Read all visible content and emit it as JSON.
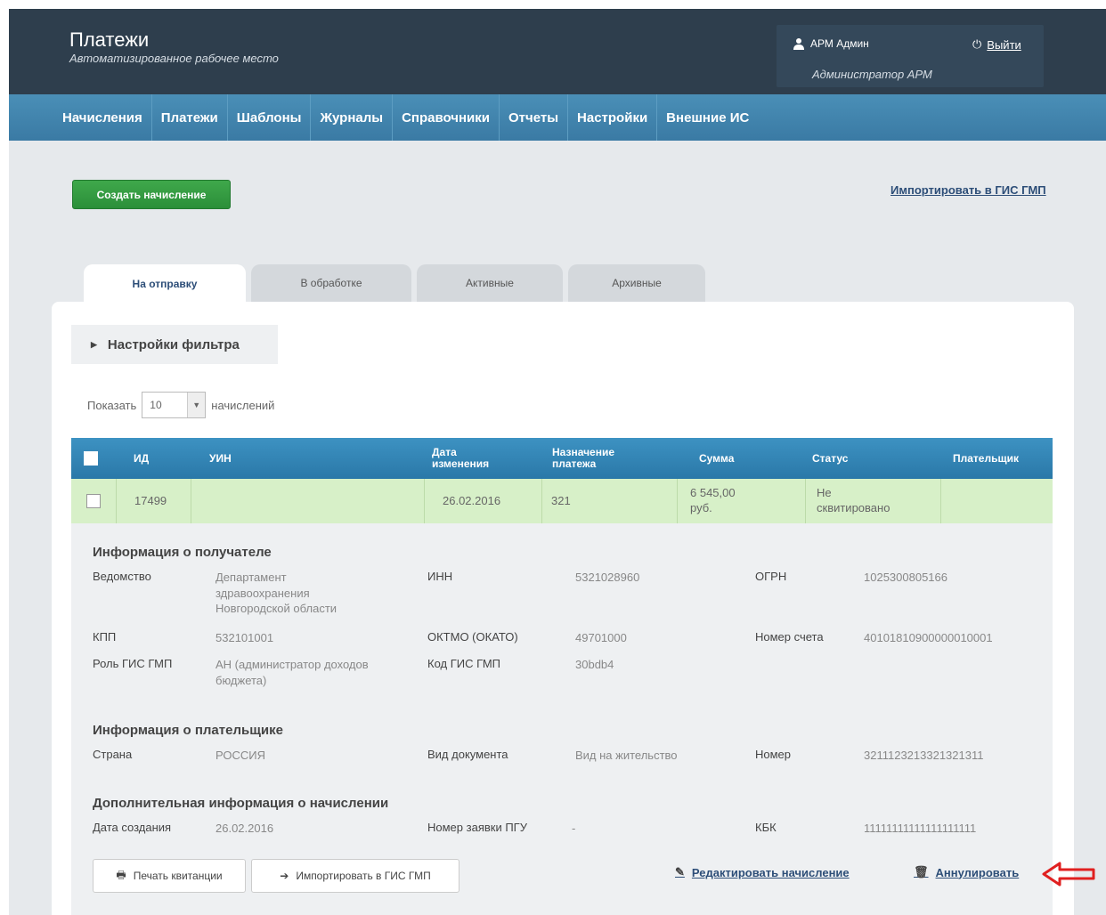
{
  "header": {
    "title": "Платежи",
    "subtitle": "Автоматизированное рабочее место",
    "user_name": "АРМ Админ",
    "user_role": "Администратор АРМ",
    "logout_label": "Выйти"
  },
  "menu": [
    {
      "label": "Начисления"
    },
    {
      "label": "Платежи"
    },
    {
      "label": "Шаблоны"
    },
    {
      "label": "Журналы"
    },
    {
      "label": "Справочники"
    },
    {
      "label": "Отчеты"
    },
    {
      "label": "Настройки"
    },
    {
      "label": "Внешние ИС"
    }
  ],
  "actions": {
    "create_label": "Создать начисление",
    "import_label": "Импортировать в ГИС ГМП"
  },
  "tabs": [
    {
      "label": "На отправку",
      "active": true
    },
    {
      "label": "В обработке",
      "active": false
    },
    {
      "label": "Активные",
      "active": false
    },
    {
      "label": "Архивные",
      "active": false
    }
  ],
  "filter": {
    "toggle_label": "Настройки фильтра",
    "show_label": "Показать",
    "page_size": "10",
    "unit_label": "начислений"
  },
  "table": {
    "columns": [
      "ИД",
      "УИН",
      "Дата изменения",
      "Назначение платежа",
      "Сумма",
      "Статус",
      "Плательщик"
    ],
    "row": {
      "id": "17499",
      "uin": "",
      "date": "26.02.2016",
      "purpose": "321",
      "amount": "6 545,00 руб.",
      "status": "Не сквитировано",
      "payer": ""
    }
  },
  "recipient": {
    "title": "Информация о получателе",
    "dept_label": "Ведомство",
    "dept_value": "Департамент здравоохранения Новгородской области",
    "inn_label": "ИНН",
    "inn_value": "5321028960",
    "ogrn_label": "ОГРН",
    "ogrn_value": "1025300805166",
    "kpp_label": "КПП",
    "kpp_value": "532101001",
    "oktmo_label": "ОКТМО (ОКАТО)",
    "oktmo_value": "49701000",
    "account_label": "Номер счета",
    "account_value": "40101810900000010001",
    "role_label": "Роль ГИС ГМП",
    "role_value": "АН (администратор доходов бюджета)",
    "code_label": "Код ГИС ГМП",
    "code_value": "30bdb4"
  },
  "payer": {
    "title": "Информация о плательщике",
    "country_label": "Страна",
    "country_value": "РОССИЯ",
    "doctype_label": "Вид документа",
    "doctype_value": "Вид на жительство",
    "number_label": "Номер",
    "number_value": "3211123213321321311"
  },
  "extra": {
    "title": "Дополнительная информация о начислении",
    "created_label": "Дата создания",
    "created_value": "26.02.2016",
    "pgu_label": "Номер заявки ПГУ",
    "pgu_value": "-",
    "kbk_label": "КБК",
    "kbk_value": "11111111111111111111"
  },
  "footer_actions": {
    "print_label": "Печать квитанции",
    "import_label": "Импортировать в ГИС ГМП",
    "edit_label": "Редактировать начисление",
    "cancel_label": "Аннулировать"
  }
}
